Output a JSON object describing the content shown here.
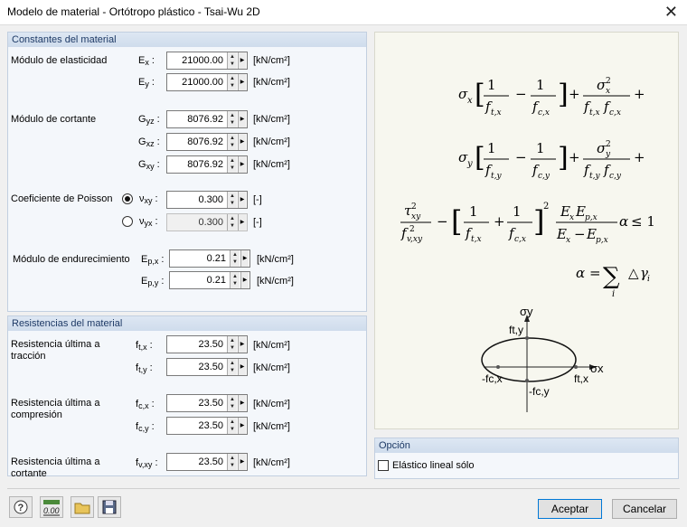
{
  "window": {
    "title": "Modelo de material - Ortótropo plástico - Tsai-Wu 2D"
  },
  "constants": {
    "header": "Constantes del material",
    "elasticity_label": "Módulo de elasticidad",
    "ex": {
      "sym": "E",
      "sub": "x",
      "value": "21000.00",
      "unit": "[kN/cm²]"
    },
    "ey": {
      "sym": "E",
      "sub": "y",
      "value": "21000.00",
      "unit": "[kN/cm²]"
    },
    "shear_label": "Módulo de cortante",
    "gyz": {
      "sym": "G",
      "sub": "yz",
      "value": "8076.92",
      "unit": "[kN/cm²]"
    },
    "gxz": {
      "sym": "G",
      "sub": "xz",
      "value": "8076.92",
      "unit": "[kN/cm²]"
    },
    "gxy": {
      "sym": "G",
      "sub": "xy",
      "value": "8076.92",
      "unit": "[kN/cm²]"
    },
    "poisson_label": "Coeficiente de Poisson",
    "vxy": {
      "sym": "ν",
      "sub": "xy",
      "value": "0.300",
      "unit": "[-]",
      "selected": true
    },
    "vyx": {
      "sym": "ν",
      "sub": "yx",
      "value": "0.300",
      "unit": "[-]",
      "selected": false
    },
    "hardening_label": "Módulo de endurecimiento",
    "epx": {
      "sym": "E",
      "sub": "p,x",
      "value": "0.21",
      "unit": "[kN/cm²]"
    },
    "epy": {
      "sym": "E",
      "sub": "p,y",
      "value": "0.21",
      "unit": "[kN/cm²]"
    }
  },
  "strengths": {
    "header": "Resistencias del material",
    "tension_label_1": "Resistencia última a",
    "tension_label_2": "tracción",
    "ftx": {
      "sym": "f",
      "sub": "t,x",
      "value": "23.50",
      "unit": "[kN/cm²]"
    },
    "fty": {
      "sym": "f",
      "sub": "t,y",
      "value": "23.50",
      "unit": "[kN/cm²]"
    },
    "compression_label_1": "Resistencia última a",
    "compression_label_2": "compresión",
    "fcx": {
      "sym": "f",
      "sub": "c,x",
      "value": "23.50",
      "unit": "[kN/cm²]"
    },
    "fcy": {
      "sym": "f",
      "sub": "c,y",
      "value": "23.50",
      "unit": "[kN/cm²]"
    },
    "shear_label_1": "Resistencia última a",
    "shear_label_2": "cortante",
    "fvxy": {
      "sym": "f",
      "sub": "v,xy",
      "value": "23.50",
      "unit": "[kN/cm²]"
    }
  },
  "figure": {
    "axis_y": "σy",
    "axis_x": "σx",
    "label_fty": "ft,y",
    "label_fcx": "-fc,x",
    "label_ftx": "ft,x",
    "label_fcy": "-fc,y"
  },
  "option": {
    "header": "Opción",
    "elastic_only_label": "Elástico lineal sólo",
    "elastic_only_checked": false
  },
  "buttons": {
    "ok": "Aceptar",
    "cancel": "Cancelar"
  },
  "toolbar": {
    "units_icon_text": "0.00"
  }
}
